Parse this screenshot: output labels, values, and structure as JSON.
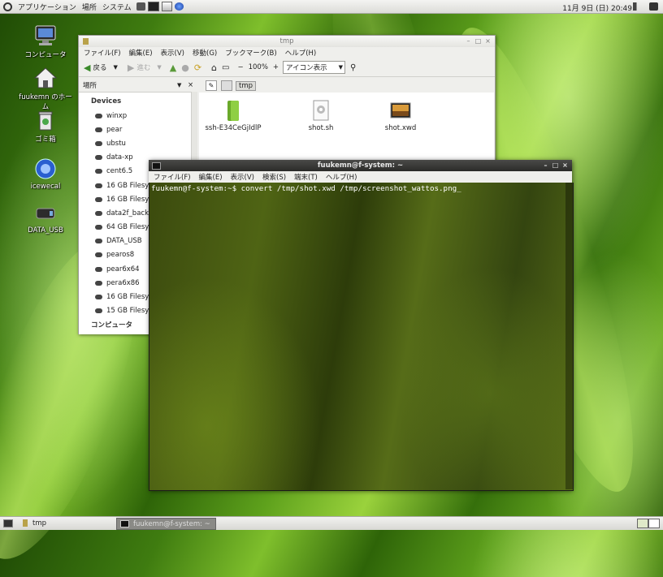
{
  "top_panel": {
    "applications": "アプリケーション",
    "places": "場所",
    "system": "システム",
    "clock": "11月 9日 (日) 20:49"
  },
  "desktop_icons": [
    {
      "label": "コンピュータ",
      "icon": "computer-icon"
    },
    {
      "label": "fuukemn のホーム",
      "icon": "home-folder-icon"
    },
    {
      "label": "ゴミ箱",
      "icon": "trash-icon"
    },
    {
      "label": "icewecal",
      "icon": "app-icon"
    },
    {
      "label": "DATA_USB",
      "icon": "usb-drive-icon"
    }
  ],
  "file_manager": {
    "title": "tmp",
    "menu": [
      "ファイル(F)",
      "編集(E)",
      "表示(V)",
      "移動(G)",
      "ブックマーク(B)",
      "ヘルプ(H)"
    ],
    "toolbar": {
      "back": "戻る",
      "forward": "進む",
      "zoom": "100%",
      "view_mode": "アイコン表示"
    },
    "sidebar": {
      "header": "場所",
      "group": "Devices",
      "items": [
        "winxp",
        "pear",
        "ubstu",
        "data-xp",
        "cent6.5",
        "16 GB Filesys",
        "16 GB Filesys",
        "data2f_backu",
        "64 GB Filesys",
        "DATA_USB",
        "pearos8",
        "pear6x64",
        "pera6x86",
        "16 GB Filesys",
        "15 GB Filesys"
      ],
      "group2": "コンピュータ"
    },
    "path": "tmp",
    "files": [
      {
        "name": "ssh-E34CeGjIdlP",
        "icon": "folder-icon"
      },
      {
        "name": "shot.sh",
        "icon": "script-file-icon"
      },
      {
        "name": "shot.xwd",
        "icon": "image-file-icon"
      }
    ]
  },
  "terminal": {
    "title": "fuukemn@f-system: ~",
    "menu": [
      "ファイル(F)",
      "編集(E)",
      "表示(V)",
      "検索(S)",
      "端末(T)",
      "ヘルプ(H)"
    ],
    "line": "fuukemn@f-system:~$ convert /tmp/shot.xwd /tmp/screenshot_wattos.png_"
  },
  "taskbar": {
    "tasks": [
      {
        "label": "tmp"
      },
      {
        "label": "fuukemn@f-system: ~"
      }
    ]
  }
}
